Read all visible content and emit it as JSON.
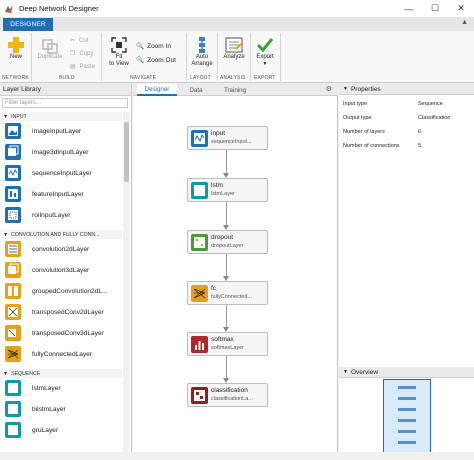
{
  "window": {
    "title": "Deep Network Designer",
    "controls": [
      "—",
      "☐",
      "✕"
    ]
  },
  "tabstrip": {
    "active_tab": "DESIGNER"
  },
  "ribbon": {
    "new_label": "New",
    "duplicate_label": "Duplicate",
    "cut_label": "Cut",
    "copy_label": "Copy",
    "paste_label": "Paste",
    "fit_label": "Fit\nto View",
    "zoom_in_label": "Zoom In",
    "zoom_out_label": "Zoom Out",
    "auto_arrange_label": "Auto\nArrange",
    "analyze_label": "Analyze",
    "export_label": "Export",
    "groups": [
      "NETWORK",
      "BUILD",
      "NAVIGATE",
      "LAYOUT",
      "ANALYSIS",
      "EXPORT"
    ]
  },
  "library": {
    "header": "Layer Library",
    "filter_placeholder": "Filter layers...",
    "sections": [
      "INPUT",
      "CONVOLUTION AND FULLY CONN...",
      "SEQUENCE"
    ],
    "input_layers": [
      "imageInputLayer",
      "image3dInputLayer",
      "sequenceInputLayer",
      "featureInputLayer",
      "roiInputLayer"
    ],
    "conv_layers": [
      "convolution2dLayer",
      "convolution3dLayer",
      "groupedConvolution2dL...",
      "transposedConv2dLayer",
      "transposedConv3dLayer",
      "fullyConnectedLayer"
    ],
    "seq_layers": [
      "lstmLayer",
      "bilstmLayer",
      "gruLayer"
    ]
  },
  "canvas": {
    "tabs": [
      "Designer",
      "Data",
      "Training"
    ],
    "active_tab": "Designer",
    "nodes": [
      {
        "title": "input",
        "subtitle": "sequenceInput..."
      },
      {
        "title": "lstm",
        "subtitle": "lstmLayer"
      },
      {
        "title": "dropout",
        "subtitle": "dropoutLayer"
      },
      {
        "title": "fc",
        "subtitle": "fullyConnected..."
      },
      {
        "title": "softmax",
        "subtitle": "softmaxLayer"
      },
      {
        "title": "classification",
        "subtitle": "classificationLa..."
      }
    ]
  },
  "properties": {
    "header": "Properties",
    "rows": [
      {
        "key": "Input type",
        "value": "Sequence"
      },
      {
        "key": "Output type",
        "value": "Classification"
      },
      {
        "key": "Number of layers",
        "value": "6"
      },
      {
        "key": "Number of connections",
        "value": "5"
      }
    ]
  },
  "overview": {
    "header": "Overview"
  },
  "colors": {
    "accent": "#1f6fb4",
    "input_icon": "#1f6fb4",
    "conv_icon": "#e6a118",
    "seq_icon": "#0c9aa8",
    "dropout_icon": "#4c9a33",
    "softmax_icon": "#b0262b",
    "classification_icon": "#8c2025"
  }
}
